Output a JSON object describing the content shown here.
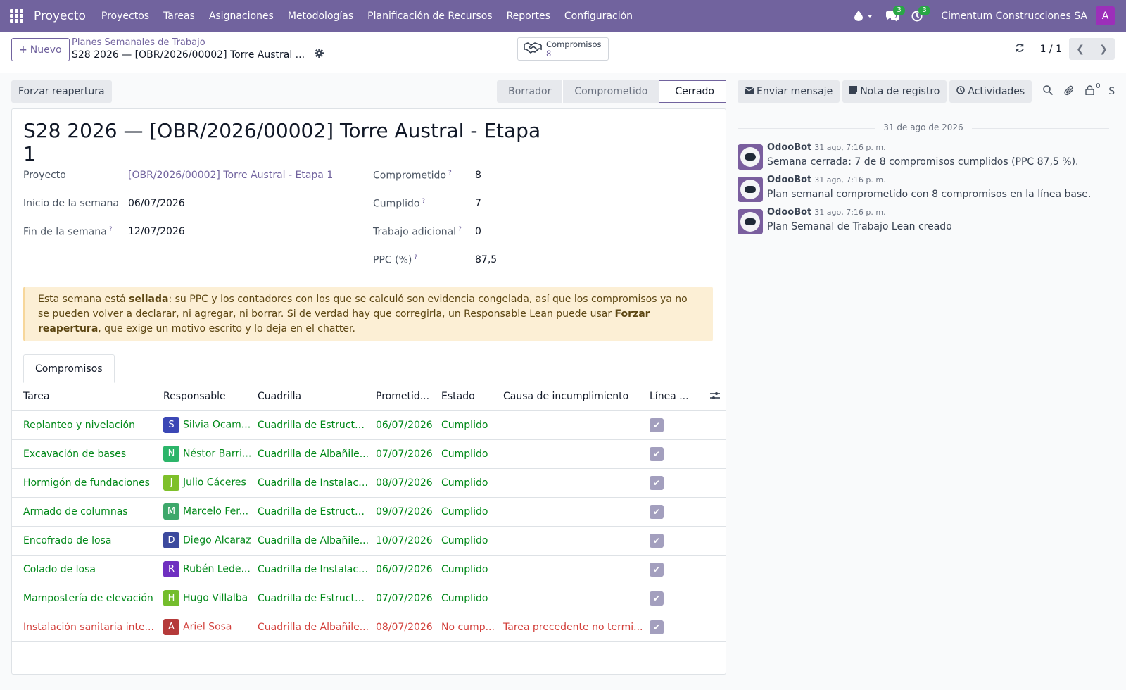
{
  "nav": {
    "app_name": "Proyecto",
    "menu": [
      "Proyectos",
      "Tareas",
      "Asignaciones",
      "Metodologías",
      "Planificación de Recursos",
      "Reportes",
      "Configuración"
    ],
    "messages_count": "3",
    "activities_count": "3",
    "company": "Cimentum Construcciones SA",
    "user_initial": "A"
  },
  "control": {
    "new_label": "Nuevo",
    "breadcrumb_parent": "Planes Semanales de Trabajo",
    "breadcrumb_current": "S28 2026 — [OBR/2026/00002] Torre Austral ...",
    "smart_label": "Compromisos",
    "smart_count": "8",
    "pager": "1 / 1"
  },
  "statusbar": {
    "force_label": "Forzar reapertura",
    "stages": [
      "Borrador",
      "Comprometido",
      "Cerrado"
    ],
    "active_stage": "Cerrado"
  },
  "form": {
    "title": "S28 2026 — [OBR/2026/00002] Torre Austral - Etapa 1",
    "left": [
      {
        "label": "Proyecto",
        "value": "[OBR/2026/00002] Torre Austral - Etapa 1",
        "help": ""
      },
      {
        "label": "Inicio de la semana",
        "value": "06/07/2026",
        "help": ""
      },
      {
        "label": "Fin de la semana",
        "value": "12/07/2026",
        "help": "?"
      }
    ],
    "right": [
      {
        "label": "Comprometido",
        "value": "8",
        "help": "?"
      },
      {
        "label": "Cumplido",
        "value": "7",
        "help": "?"
      },
      {
        "label": "Trabajo adicional",
        "value": "0",
        "help": "?"
      },
      {
        "label": "PPC (%)",
        "value": "87,5",
        "help": "?"
      }
    ],
    "alert": {
      "p1": "Esta semana está ",
      "b1": "sellada",
      "p2": ": su PPC y los contadores con los que se calculó son evidencia congelada, así que los compromisos ya no se pueden volver a declarar, ni agregar, ni borrar. Si de verdad hay que corregirla, un Responsable Lean puede usar ",
      "b2": "Forzar reapertura",
      "p3": ", que exige un motivo escrito y lo deja en el chatter."
    },
    "tab_label": "Compromisos",
    "columns": [
      "Tarea",
      "Responsable",
      "Cuadrilla",
      "Prometid...",
      "Estado",
      "Causa de incumplimiento",
      "Línea ..."
    ],
    "rows": [
      {
        "tarea": "Replanteo y nivelación",
        "initial": "S",
        "color": "#3b47b5",
        "resp": "Silvia Ocam...",
        "cuadrilla": "Cuadrilla de Estructura",
        "fecha": "06/07/2026",
        "estado": "Cumplido",
        "causa": "",
        "ok": true
      },
      {
        "tarea": "Excavación de bases",
        "initial": "N",
        "color": "#2cb56a",
        "resp": "Néstor Barri...",
        "cuadrilla": "Cuadrilla de Albañile...",
        "fecha": "07/07/2026",
        "estado": "Cumplido",
        "causa": "",
        "ok": true
      },
      {
        "tarea": "Hormigón de fundaciones",
        "initial": "J",
        "color": "#7ec02a",
        "resp": "Julio Cáceres",
        "cuadrilla": "Cuadrilla de Instalaci...",
        "fecha": "08/07/2026",
        "estado": "Cumplido",
        "causa": "",
        "ok": true
      },
      {
        "tarea": "Armado de columnas",
        "initial": "M",
        "color": "#3ea86b",
        "resp": "Marcelo Fer...",
        "cuadrilla": "Cuadrilla de Estructura",
        "fecha": "09/07/2026",
        "estado": "Cumplido",
        "causa": "",
        "ok": true
      },
      {
        "tarea": "Encofrado de losa",
        "initial": "D",
        "color": "#3c4a9e",
        "resp": "Diego Alcaraz",
        "cuadrilla": "Cuadrilla de Albañile...",
        "fecha": "10/07/2026",
        "estado": "Cumplido",
        "causa": "",
        "ok": true
      },
      {
        "tarea": "Colado de losa",
        "initial": "R",
        "color": "#6f2fc0",
        "resp": "Rubén Lede...",
        "cuadrilla": "Cuadrilla de Instalaci...",
        "fecha": "06/07/2026",
        "estado": "Cumplido",
        "causa": "",
        "ok": true
      },
      {
        "tarea": "Mampostería de elevación",
        "initial": "H",
        "color": "#74bd2c",
        "resp": "Hugo Villalba",
        "cuadrilla": "Cuadrilla de Estructura",
        "fecha": "07/07/2026",
        "estado": "Cumplido",
        "causa": "",
        "ok": true
      },
      {
        "tarea": "Instalación sanitaria inte...",
        "initial": "A",
        "color": "#b53a3a",
        "resp": "Ariel Sosa",
        "cuadrilla": "Cuadrilla de Albañile...",
        "fecha": "08/07/2026",
        "estado": "No cump...",
        "causa": "Tarea precedente no termi...",
        "ok": false
      }
    ]
  },
  "chatter": {
    "send_label": "Enviar mensaje",
    "note_label": "Nota de registro",
    "activities_label": "Actividades",
    "followers_count": "0",
    "follow_label": "S",
    "date_separator": "31 de ago de 2026",
    "messages": [
      {
        "author": "OdooBot",
        "date": "31 ago, 7:16 p. m.",
        "body": "Semana cerrada: 7 de 8 compromisos cumplidos (PPC 87,5 %)."
      },
      {
        "author": "OdooBot",
        "date": "31 ago, 7:16 p. m.",
        "body": "Plan semanal comprometido con 8 compromisos en la línea base."
      },
      {
        "author": "OdooBot",
        "date": "31 ago, 7:16 p. m.",
        "body": "Plan Semanal de Trabajo Lean creado"
      }
    ]
  }
}
